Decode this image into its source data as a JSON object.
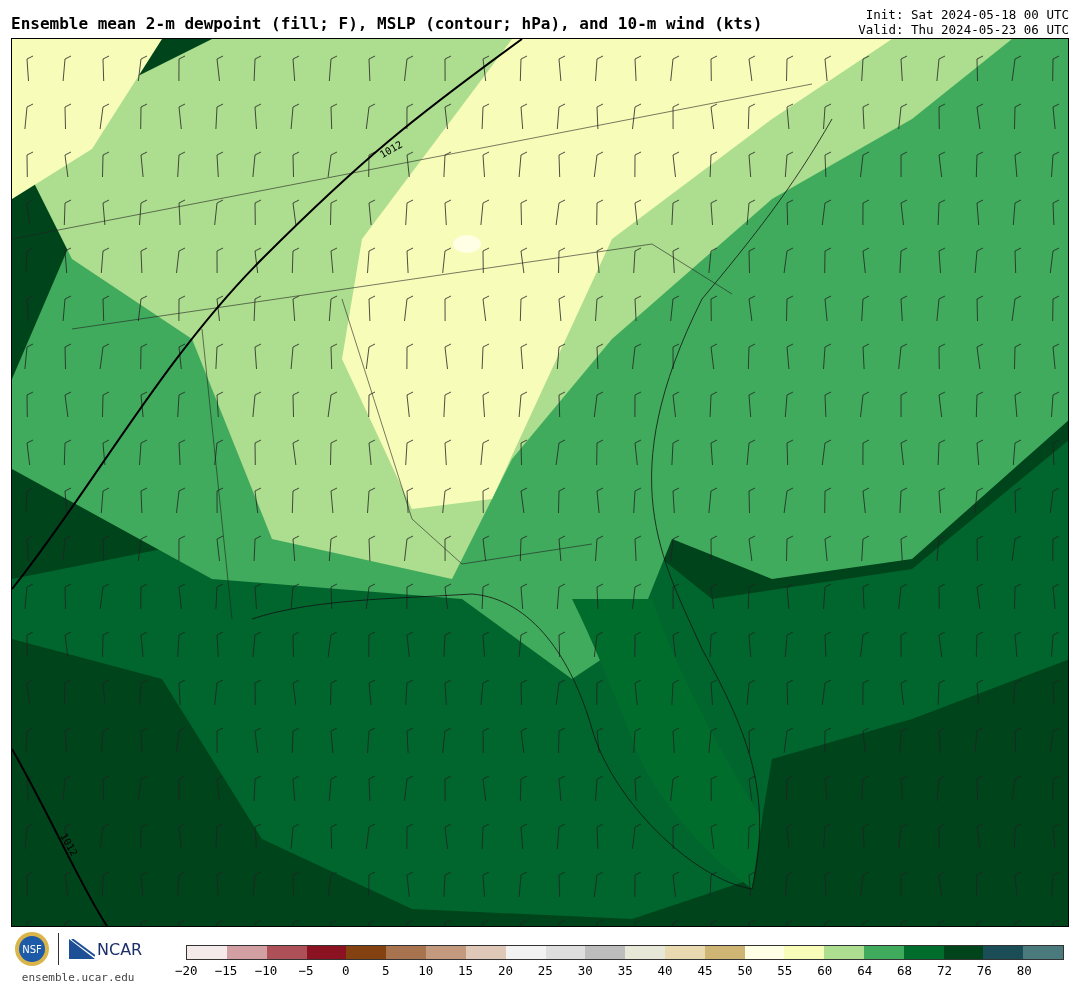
{
  "header": {
    "title": "Ensemble mean 2-m dewpoint (fill; F), MSLP (contour; hPa), and 10-m wind (kts)",
    "init": "Init: Sat 2024-05-18 00 UTC",
    "valid": "Valid: Thu 2024-05-23 06 UTC"
  },
  "map": {
    "contour_labels": [
      "1012",
      "1012"
    ]
  },
  "footer": {
    "logos": [
      {
        "kind": "seal",
        "text": "NSF"
      },
      {
        "kind": "wordmark",
        "text": "NCAR"
      }
    ],
    "website": "ensemble.ucar.edu"
  },
  "colorbar": {
    "bins": [
      {
        "color": "#f5eaea"
      },
      {
        "color": "#d29fa3"
      },
      {
        "color": "#ad5057"
      },
      {
        "color": "#8b1220"
      },
      {
        "color": "#844211"
      },
      {
        "color": "#a87450"
      },
      {
        "color": "#c49a7e"
      },
      {
        "color": "#e0c8b8"
      },
      {
        "color": "#f2f2f2"
      },
      {
        "color": "#dedede"
      },
      {
        "color": "#bdbdbd"
      },
      {
        "color": "#e8e8d8"
      },
      {
        "color": "#e8d9b0"
      },
      {
        "color": "#cfb574"
      },
      {
        "color": "#ffffe5"
      },
      {
        "color": "#f7fcb9"
      },
      {
        "color": "#addd8e"
      },
      {
        "color": "#41ab5d"
      },
      {
        "color": "#006d2c"
      },
      {
        "color": "#00441b"
      },
      {
        "color": "#1a4d55"
      },
      {
        "color": "#4a7a7c"
      }
    ],
    "ticks": [
      "−20",
      "−15",
      "−10",
      "−5",
      "0",
      "5",
      "10",
      "15",
      "20",
      "25",
      "30",
      "35",
      "40",
      "45",
      "50",
      "55",
      "60",
      "64",
      "68",
      "72",
      "76",
      "80"
    ]
  }
}
